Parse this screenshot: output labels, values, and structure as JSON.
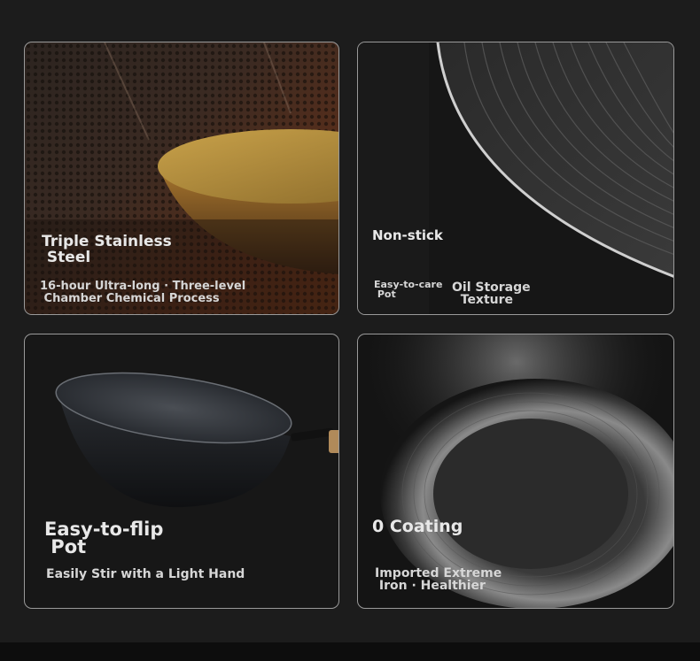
{
  "cards": [
    {
      "title_line1": "Triple Stainless",
      "title_line2": " Steel",
      "desc_line1": "16-hour Ultra-long · Three-level",
      "desc_line2": " Chamber Chemical Process"
    },
    {
      "title": "Non-stick",
      "note_line1": "Easy-to-care",
      "note_line2": " Pot",
      "desc_line1": "Oil Storage",
      "desc_line2": "  Texture"
    },
    {
      "title_line1": "Easy-to-flip",
      "title_line2": " Pot",
      "desc": "Easily Stir with a Light Hand"
    },
    {
      "title": "0 Coating",
      "desc_line1": "Imported Extreme",
      "desc_line2": " Iron · Healthier"
    }
  ]
}
